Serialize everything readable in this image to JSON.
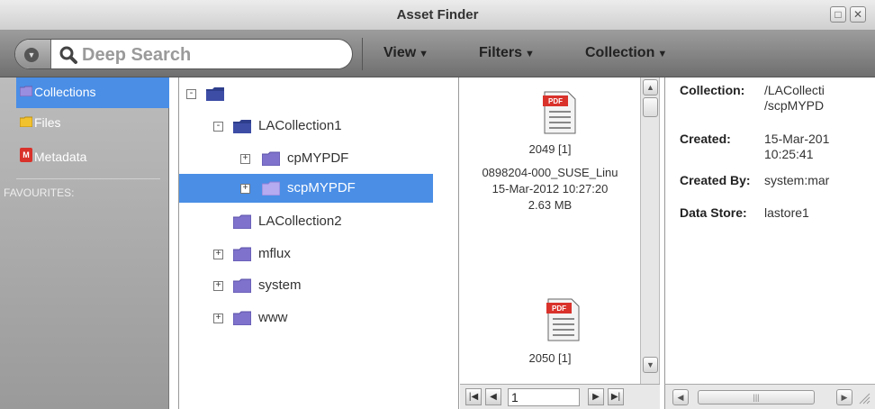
{
  "window": {
    "title": "Asset Finder"
  },
  "toolbar": {
    "search_placeholder": "Deep Search",
    "view_label": "View",
    "filters_label": "Filters",
    "collection_label": "Collection"
  },
  "sidebar": {
    "items": [
      {
        "label": "Collections",
        "icon": "collections-folder-icon"
      },
      {
        "label": "Files",
        "icon": "files-folder-icon"
      },
      {
        "label": "Metadata",
        "icon": "metadata-icon"
      }
    ],
    "favourites_label": "FAVOURITES:"
  },
  "tree": {
    "nodes": [
      {
        "label": ""
      },
      {
        "label": "LACollection1"
      },
      {
        "label": "cpMYPDF"
      },
      {
        "label": "scpMYPDF"
      },
      {
        "label": "LACollection2"
      },
      {
        "label": "mflux"
      },
      {
        "label": "system"
      },
      {
        "label": "www"
      }
    ]
  },
  "files": [
    {
      "id": "2049 [1]",
      "name": "0898204-000_SUSE_Linu",
      "date": "15-Mar-2012 10:27:20",
      "size": "2.63 MB"
    },
    {
      "id": "2050 [1]"
    }
  ],
  "pager": {
    "page": "1"
  },
  "details": {
    "collection_label": "Collection:",
    "collection_value_1": "/LACollecti",
    "collection_value_2": "/scpMYPD",
    "created_label": "Created:",
    "created_value_1": "15-Mar-201",
    "created_value_2": "10:25:41",
    "created_by_label": "Created By:",
    "created_by_value": "system:mar",
    "data_store_label": "Data Store:",
    "data_store_value": "lastore1"
  },
  "colors": {
    "selection": "#4a8ee6",
    "folder": "#8b7fd6",
    "pdf_red": "#d9322b"
  }
}
